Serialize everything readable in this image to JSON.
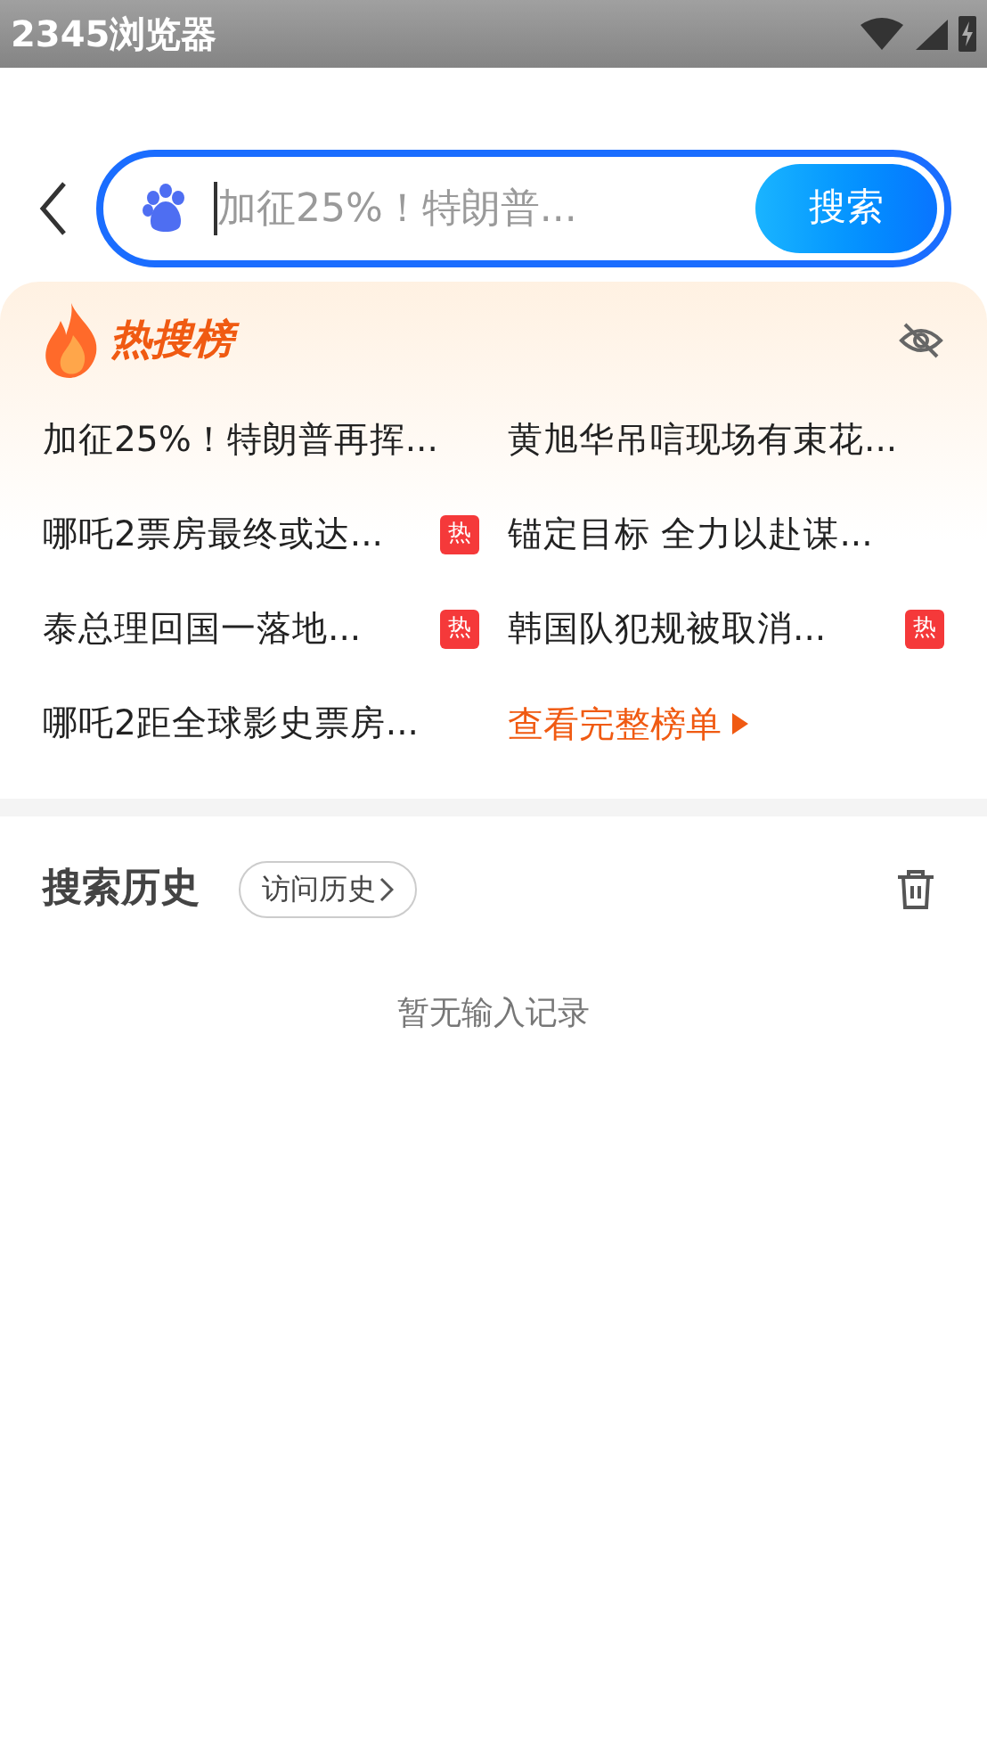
{
  "status_bar": {
    "title": "2345浏览器"
  },
  "search": {
    "placeholder": "加征25%！特朗普...",
    "button": "搜索"
  },
  "hot_list": {
    "title": "热搜榜",
    "items": [
      {
        "text": "加征25%！特朗普再挥..."
      },
      {
        "text": "黄旭华吊唁现场有束花..."
      },
      {
        "text": "哪吒2票房最终或达...",
        "badge": "热"
      },
      {
        "text": "锚定目标 全力以赴谋..."
      },
      {
        "text": "泰总理回国一落地...",
        "badge": "热"
      },
      {
        "text": "韩国队犯规被取消...",
        "badge": "热"
      },
      {
        "text": "哪吒2距全球影史票房..."
      }
    ],
    "more_link": "查看完整榜单"
  },
  "history": {
    "title": "搜索历史",
    "visit_button": "访问历史",
    "empty_text": "暂无输入记录"
  }
}
